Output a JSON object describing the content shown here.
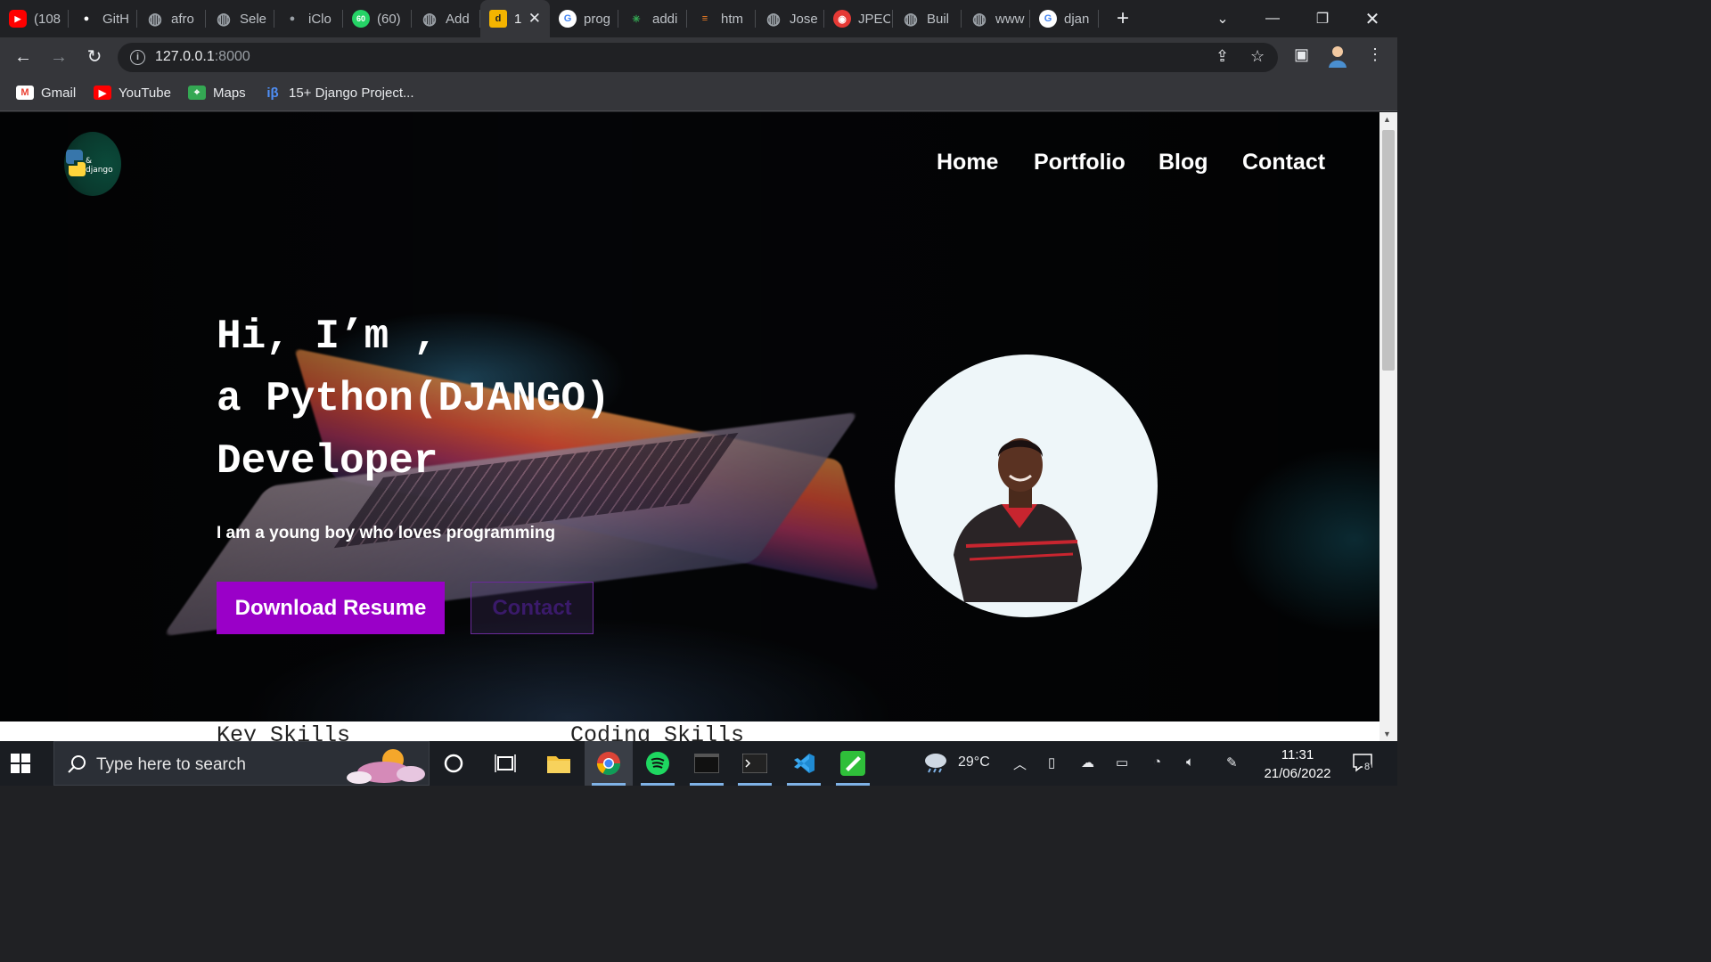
{
  "browser": {
    "tabs": [
      {
        "title": "(108",
        "icon": "youtube-icon",
        "color": "#ff0000"
      },
      {
        "title": "GitH",
        "icon": "github-icon",
        "color": "#ffffff"
      },
      {
        "title": "afro",
        "icon": "globe-icon",
        "color": "#9aa0a6"
      },
      {
        "title": "Sele",
        "icon": "globe-icon",
        "color": "#9aa0a6"
      },
      {
        "title": "iClo",
        "icon": "apple-icon",
        "color": "#9aa0a6"
      },
      {
        "title": "(60)",
        "icon": "whatsapp-icon",
        "color": "#25d366"
      },
      {
        "title": "Add",
        "icon": "globe-icon",
        "color": "#9aa0a6"
      },
      {
        "title": "1",
        "icon": "d-icon",
        "color": "#f4b400"
      },
      {
        "title": "prog",
        "icon": "google-icon",
        "color": "#ffffff"
      },
      {
        "title": "addi",
        "icon": "pinwheel-icon",
        "color": "#34a853"
      },
      {
        "title": "htm",
        "icon": "stackoverflow-icon",
        "color": "#f48024"
      },
      {
        "title": "Jose",
        "icon": "globe-icon",
        "color": "#9aa0a6"
      },
      {
        "title": "JPEC",
        "icon": "jpeg-icon",
        "color": "#e53935"
      },
      {
        "title": "Buil",
        "icon": "globe-icon",
        "color": "#9aa0a6"
      },
      {
        "title": "www",
        "icon": "globe-icon",
        "color": "#9aa0a6"
      },
      {
        "title": "djan",
        "icon": "google-icon",
        "color": "#ffffff"
      }
    ],
    "active_tab": 7,
    "url_host": "127.0.0.1",
    "url_port": ":8000",
    "bookmarks": [
      {
        "label": "Gmail",
        "icon": "gmail-icon",
        "color": "#ea4335"
      },
      {
        "label": "YouTube",
        "icon": "youtube-icon",
        "color": "#ff0000"
      },
      {
        "label": "Maps",
        "icon": "maps-icon",
        "color": "#34a853"
      },
      {
        "label": "15+ Django Project...",
        "icon": "ib-icon",
        "color": "#4f8ff7"
      }
    ]
  },
  "site": {
    "logo_text": "& django",
    "nav": [
      "Home",
      "Portfolio",
      "Blog",
      "Contact"
    ],
    "hero": {
      "line1": "Hi, I’m ,",
      "line2": "a Python(DJANGO)",
      "line3": "Developer",
      "subtitle": "I am a young boy who loves programming",
      "primary_button": "Download Resume",
      "secondary_button": "Contact"
    },
    "sections": [
      "Key Skills",
      "Coding Skills"
    ],
    "accent_color": "#9a00c8"
  },
  "taskbar": {
    "search_placeholder": "Type here to search",
    "weather": "29°C",
    "time": "11:31",
    "date": "21/06/2022",
    "notifications": "8"
  }
}
